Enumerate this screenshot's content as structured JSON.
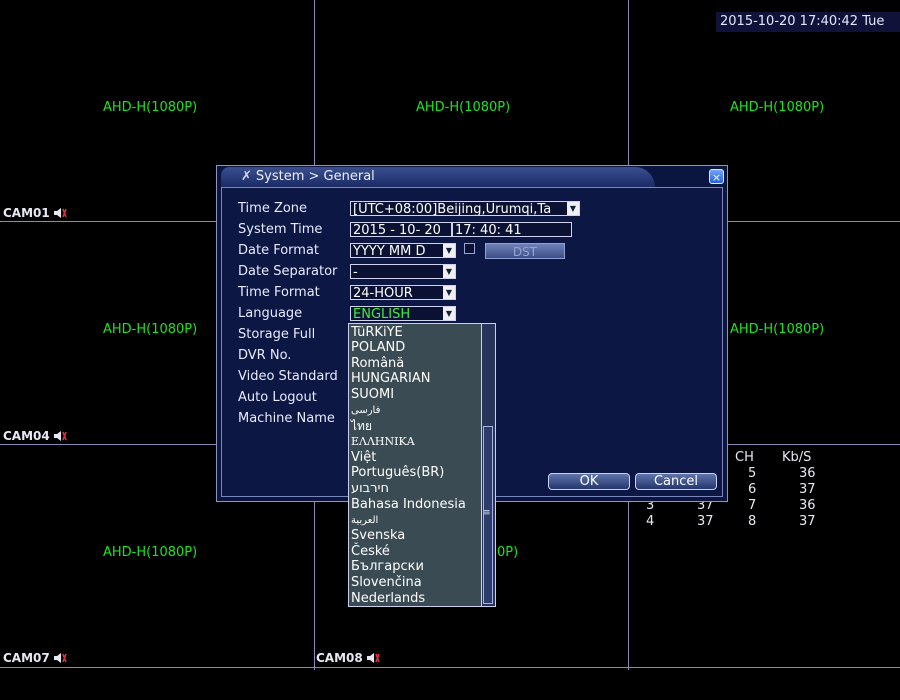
{
  "datetime_bar": "2015-10-20 17:40:42 Tue",
  "cameras": {
    "cells": [
      {
        "format": "AHD-H(1080P)"
      },
      {
        "format": "AHD-H(1080P)"
      },
      {
        "format": "AHD-H(1080P)"
      },
      {
        "format": "AHD-H(1080P)"
      },
      {
        "format": "AHD-H(1080P)"
      },
      {
        "format": "AHD-H(1080P)"
      },
      {
        "format": "0P)"
      }
    ],
    "labels": [
      "CAM01",
      "CAM04",
      "CAM07",
      "CAM08"
    ]
  },
  "stats": {
    "headers": [
      "CH",
      "Kb/S"
    ],
    "rows": [
      [
        "5",
        "36"
      ],
      [
        "6",
        "37"
      ],
      [
        "3",
        "37",
        "7",
        "36"
      ],
      [
        "4",
        "37",
        "8",
        "37"
      ]
    ]
  },
  "dialog": {
    "title": "System > General",
    "close_glyph": "×",
    "labels": {
      "time_zone": "Time Zone",
      "system_time": "System Time",
      "date_format": "Date Format",
      "date_separator": "Date Separator",
      "time_format": "Time Format",
      "language": "Language",
      "storage_full": "Storage Full",
      "dvr_no": "DVR No.",
      "video_standard": "Video Standard",
      "auto_logout": "Auto Logout",
      "machine_name": "Machine Name"
    },
    "values": {
      "time_zone": "[UTC+08:00]Beijing,Urumqi,Ta",
      "date": "2015 - 10- 20",
      "time": "17: 40: 41",
      "date_format": "YYYY MM D",
      "date_separator": "-",
      "time_format": "24-HOUR",
      "language": "ENGLISH"
    },
    "dst_label": "DST",
    "ok_label": "OK",
    "cancel_label": "Cancel",
    "language_options": [
      "TüRKiYE",
      "POLAND",
      "Română",
      "HUNGARIAN",
      "SUOMI",
      "فارسی",
      "ไทย",
      "ΕΛΛΗΝΙΚΑ",
      "Việt",
      "Português(BR)",
      "חירבוע",
      "Bahasa Indonesia",
      "العربية",
      "Svenska",
      "České",
      "Български",
      "Slovenčina",
      "Nederlands"
    ]
  },
  "colors": {
    "format_text": "#19e619",
    "grid": "#8f86b8",
    "dialog_bg": "#0b1640",
    "list_bg": "#3a4b53"
  }
}
